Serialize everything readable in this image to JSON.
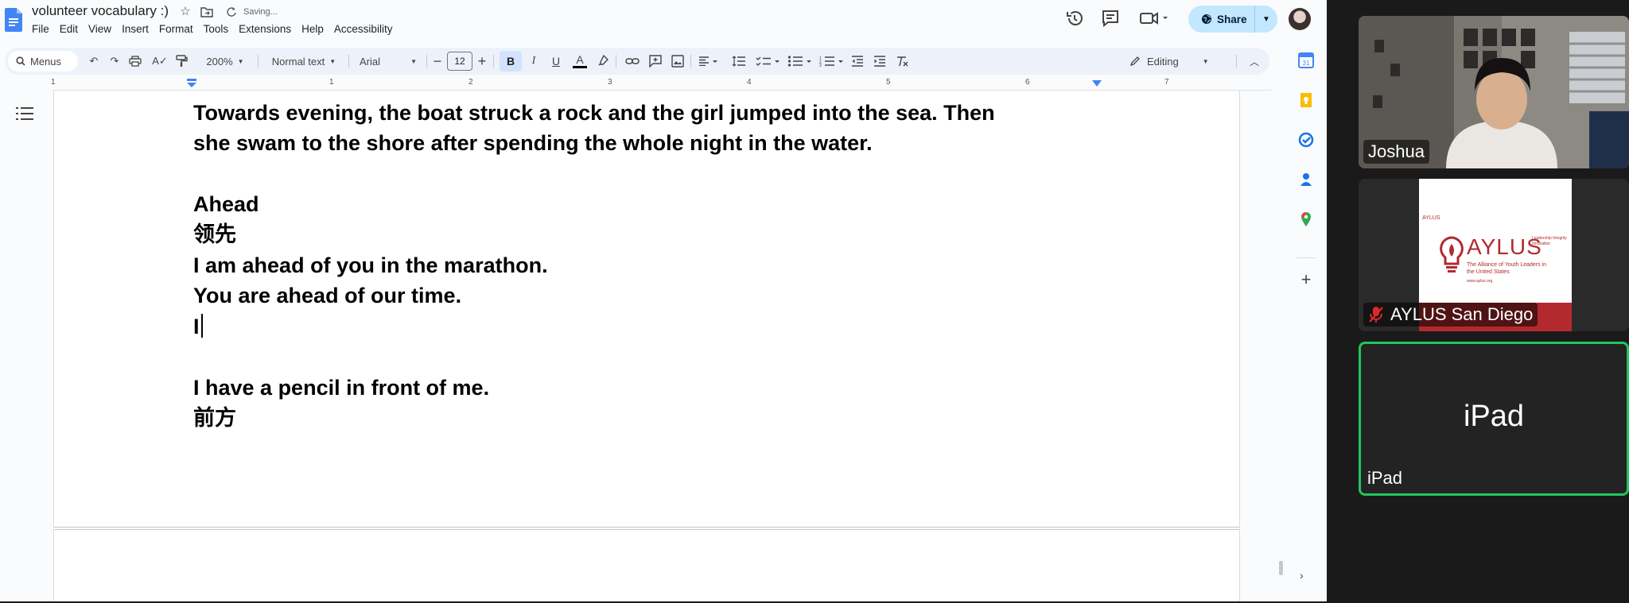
{
  "document": {
    "title": "volunteer vocabulary :)",
    "save_status": "Saving...",
    "menus": [
      "File",
      "Edit",
      "View",
      "Insert",
      "Format",
      "Tools",
      "Extensions",
      "Help",
      "Accessibility"
    ]
  },
  "header": {
    "share_label": "Share"
  },
  "toolbar": {
    "menus_label": "Menus",
    "zoom": "200%",
    "style": "Normal text",
    "font": "Arial",
    "font_size": "12",
    "mode": "Editing"
  },
  "ruler": {
    "numbers": [
      "1",
      "1",
      "2",
      "3",
      "4",
      "5",
      "6",
      "7"
    ]
  },
  "content": {
    "lines": [
      "Towards evening, the boat struck a rock and the girl jumped into the sea. Then",
      "she swam to the shore after spending the whole night in the water.",
      "",
      "Ahead",
      "领先",
      "I am ahead of you in the marathon.",
      "You are ahead of our time.",
      "I",
      "",
      "I have a pencil in front of me.",
      "前方"
    ]
  },
  "video": {
    "participants": [
      {
        "name": "Joshua"
      },
      {
        "name": "AYLUS San Diego",
        "muted": true,
        "logo_text": "AYLUS",
        "logo_tagline": "The Alliance of Youth Leaders in the United States",
        "logo_small": "AYLUS",
        "logo_side": "Leadership Integrity Innovation",
        "logo_url": "www.aylus.org"
      },
      {
        "name": "iPad",
        "center_name": "iPad",
        "active_speaker": true
      }
    ]
  },
  "colors": {
    "docs_bg": "#f9fbfd",
    "share_bg": "#c2e7ff",
    "toolbar_bg": "#edf2fa",
    "active_speaker": "#22c55e",
    "aylus_red": "#b22a2e"
  }
}
